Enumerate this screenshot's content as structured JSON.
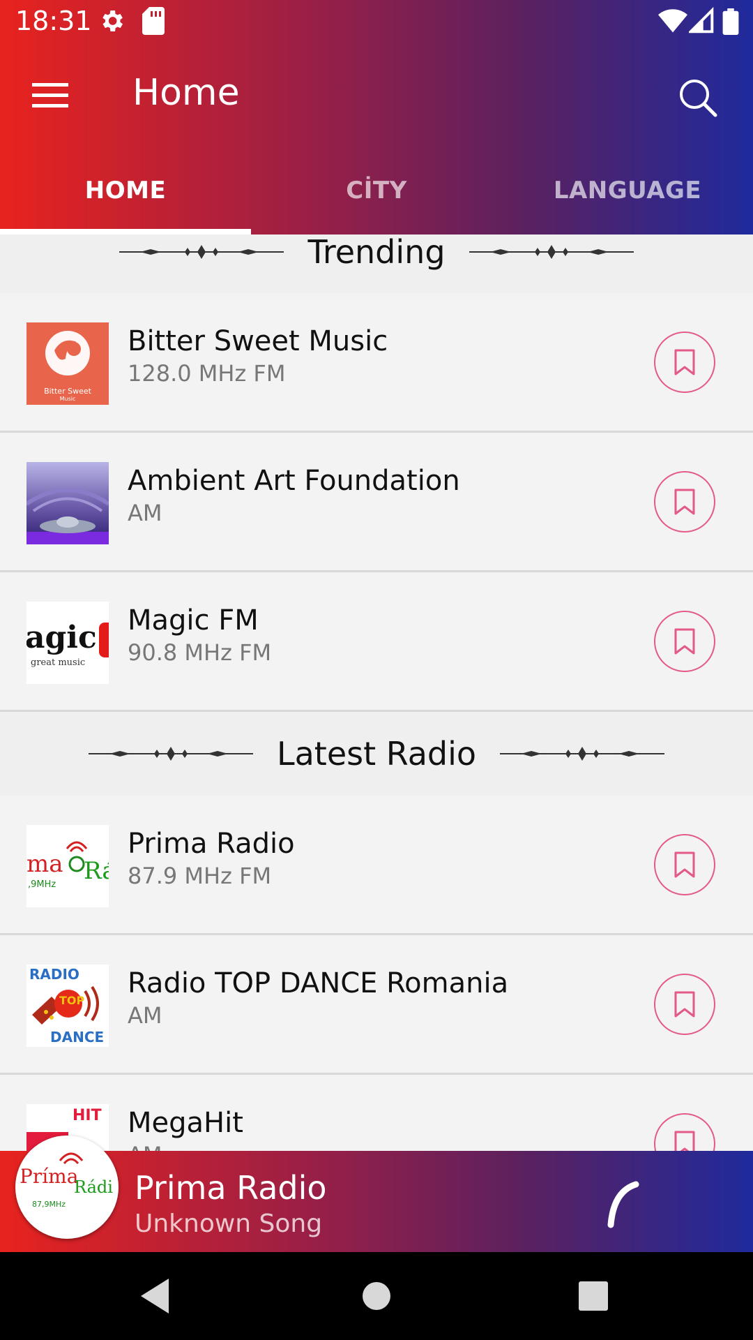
{
  "status_bar": {
    "time": "18:31"
  },
  "toolbar": {
    "title": "Home"
  },
  "tabs": [
    {
      "label": "HOME",
      "active": true
    },
    {
      "label": "CİTY",
      "active": false
    },
    {
      "label": "LANGUAGE",
      "active": false
    }
  ],
  "sections": {
    "trending": {
      "title": "Trending",
      "stations": [
        {
          "name": "Bitter Sweet Music",
          "freq": "128.0 MHz FM",
          "logo_text": "Bitter Sweet",
          "logo_sub": "Music"
        },
        {
          "name": "Ambient Art Foundation",
          "freq": "AM"
        },
        {
          "name": "Magic FM",
          "freq": "90.8 MHz FM",
          "logo_text": "agic F",
          "logo_sub": "great music"
        }
      ]
    },
    "latest": {
      "title": "Latest Radio",
      "stations": [
        {
          "name": "Prima Radio",
          "freq": "87.9 MHz FM",
          "logo_text": "ma",
          "logo_sub": ",9MHz",
          "logo_right": "Rá"
        },
        {
          "name": "Radio TOP DANCE Romania",
          "freq": "AM",
          "logo_top": "RADIO",
          "logo_mid": "TOP",
          "logo_bottom": "DANCE"
        },
        {
          "name": "MegaHit",
          "freq": "AM",
          "logo_text": "HIT"
        }
      ]
    }
  },
  "player": {
    "station": "Prima Radio",
    "song": "Unknown Song",
    "art_text": "Príma",
    "art_sub": "87,9MHz",
    "art_right": "Rádi"
  },
  "colors": {
    "gradient_start": "#e8231e",
    "gradient_end": "#1f2a9c",
    "accent_pink": "#e35a86"
  }
}
